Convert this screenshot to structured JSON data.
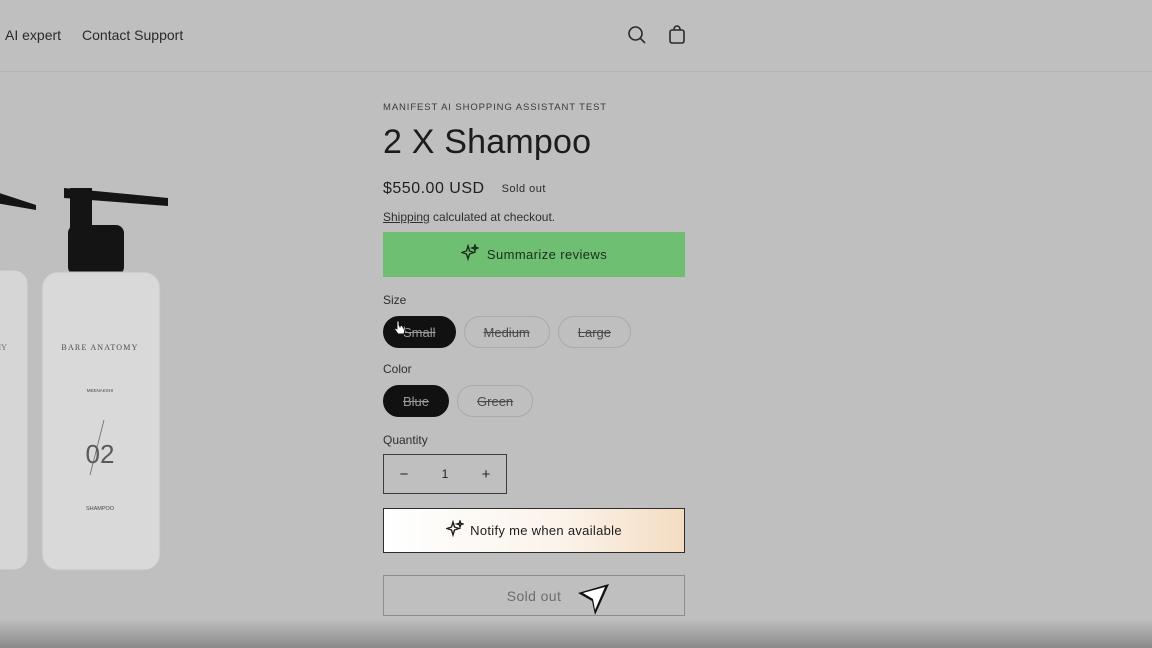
{
  "header": {
    "nav": [
      "AI expert",
      "Contact Support"
    ],
    "search_icon": "search-icon",
    "cart_icon": "cart-icon"
  },
  "product": {
    "vendor": "MANIFEST AI SHOPPING ASSISTANT TEST",
    "title": "2 X Shampoo",
    "price": "$550.00 USD",
    "badge": "Sold out",
    "shipping_link": "Shipping",
    "shipping_text": " calculated at checkout.",
    "image": {
      "brand_text": "BARE ANATOMY",
      "sub_text": "MEENAKSHI",
      "number_text": "02",
      "bottom_text": "SHAMPOO"
    }
  },
  "actions": {
    "summarize_label": "Summarize reviews",
    "notify_label": "Notify me when available",
    "soldout_label": "Sold out"
  },
  "options": {
    "size_label": "Size",
    "sizes": [
      "Small",
      "Medium",
      "Large"
    ],
    "selected_size": "Small",
    "color_label": "Color",
    "colors": [
      "Blue",
      "Green"
    ],
    "selected_color": "Blue"
  },
  "quantity": {
    "label": "Quantity",
    "value": "1",
    "minus": "−",
    "plus": "+"
  },
  "colors": {
    "page_bg": "#bfbfbf",
    "summarize_bg": "#6fbf73",
    "selected_pill": "#111111"
  }
}
